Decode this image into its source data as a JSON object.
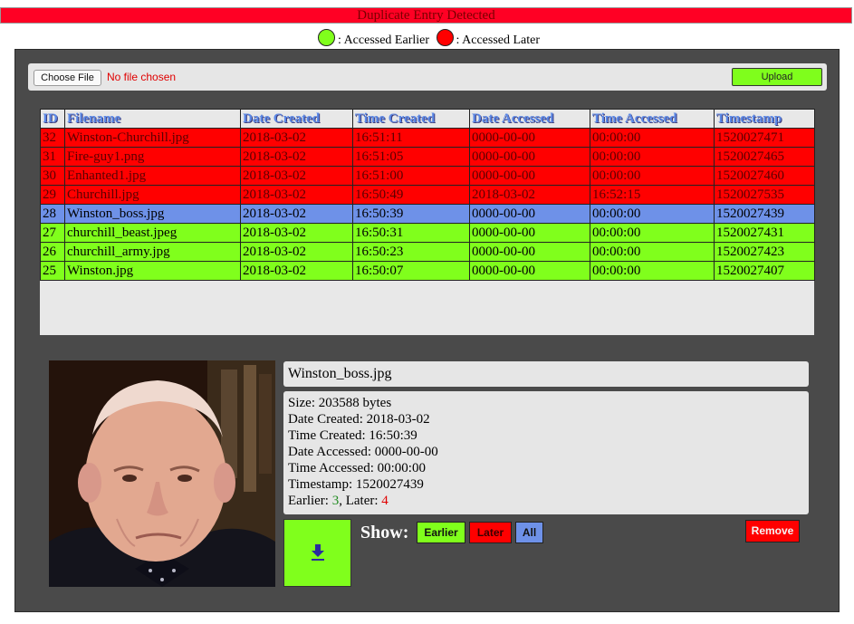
{
  "banner": {
    "text": "Duplicate Entry Detected"
  },
  "legend": {
    "earlier_label": ": Accessed Earlier",
    "later_label": ": Accessed Later",
    "earlier_color": "#80ff1c",
    "later_color": "#ff0000"
  },
  "upload": {
    "choose_label": "Choose File",
    "no_file_text": "No file chosen",
    "upload_label": "Upload"
  },
  "table": {
    "headers": [
      "ID",
      "Filename",
      "Date Created",
      "Time Created",
      "Date Accessed",
      "Time Accessed",
      "Timestamp"
    ],
    "rows": [
      {
        "status": "red",
        "cells": [
          "32",
          "Winston-Churchill.jpg",
          "2018-03-02",
          "16:51:11",
          "0000-00-00",
          "00:00:00",
          "1520027471"
        ]
      },
      {
        "status": "red",
        "cells": [
          "31",
          "Fire-guy1.png",
          "2018-03-02",
          "16:51:05",
          "0000-00-00",
          "00:00:00",
          "1520027465"
        ]
      },
      {
        "status": "red",
        "cells": [
          "30",
          "Enhanted1.jpg",
          "2018-03-02",
          "16:51:00",
          "0000-00-00",
          "00:00:00",
          "1520027460"
        ]
      },
      {
        "status": "red",
        "cells": [
          "29",
          "Churchill.jpg",
          "2018-03-02",
          "16:50:49",
          "2018-03-02",
          "16:52:15",
          "1520027535"
        ]
      },
      {
        "status": "blue",
        "cells": [
          "28",
          "Winston_boss.jpg",
          "2018-03-02",
          "16:50:39",
          "0000-00-00",
          "00:00:00",
          "1520027439"
        ]
      },
      {
        "status": "green",
        "cells": [
          "27",
          "churchill_beast.jpeg",
          "2018-03-02",
          "16:50:31",
          "0000-00-00",
          "00:00:00",
          "1520027431"
        ]
      },
      {
        "status": "green",
        "cells": [
          "26",
          "churchill_army.jpg",
          "2018-03-02",
          "16:50:23",
          "0000-00-00",
          "00:00:00",
          "1520027423"
        ]
      },
      {
        "status": "green",
        "cells": [
          "25",
          "Winston.jpg",
          "2018-03-02",
          "16:50:07",
          "0000-00-00",
          "00:00:00",
          "1520027407"
        ]
      }
    ]
  },
  "selected": {
    "filename": "Winston_boss.jpg",
    "size": "Size: 203588 bytes",
    "date_created": "Date Created: 2018-03-02",
    "time_created": "Time Created: 16:50:39",
    "date_accessed": "Date Accessed: 0000-00-00",
    "time_accessed": "Time Accessed: 00:00:00",
    "timestamp": "Timestamp: 1520027439",
    "earlier_prefix": "Earlier: ",
    "earlier_count": "3",
    "later_prefix": ", Later: ",
    "later_count": "4"
  },
  "controls": {
    "download_icon": "download-icon",
    "show_label": "Show:",
    "earlier_label": "Earlier",
    "later_label": "Later",
    "all_label": "All",
    "remove_label": "Remove"
  }
}
